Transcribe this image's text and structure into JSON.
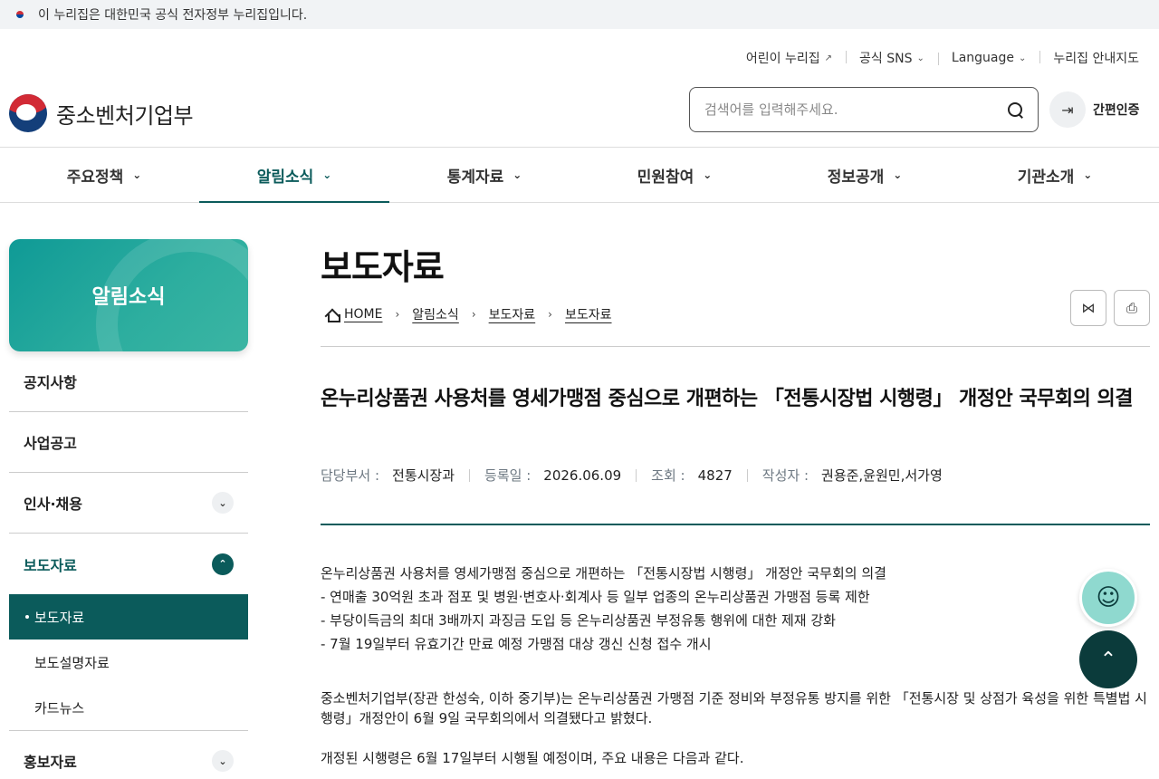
{
  "gov_banner": {
    "text": "이 누리집은 대한민국 공식 전자정부 누리집입니다."
  },
  "utility": [
    {
      "label": "어린이 누리집",
      "icon": "↗"
    },
    {
      "label": "공식 SNS",
      "icon": "⌄"
    },
    {
      "label": "Language",
      "icon": "⌄"
    },
    {
      "label": "누리집 안내지도",
      "icon": ""
    }
  ],
  "logo": {
    "text": "중소벤처기업부"
  },
  "search": {
    "placeholder": "검색어를 입력해주세요."
  },
  "login": {
    "label": "간편인증",
    "icon": "⇥"
  },
  "gnb": [
    {
      "label": "주요정책"
    },
    {
      "label": "알림소식"
    },
    {
      "label": "통계자료"
    },
    {
      "label": "민원참여"
    },
    {
      "label": "정보공개"
    },
    {
      "label": "기관소개"
    }
  ],
  "gnb_chevron": "⌄",
  "side": {
    "banner": "알림소식",
    "items": [
      {
        "label": "공지사항"
      },
      {
        "label": "사업공고"
      },
      {
        "label": "인사·채용",
        "toggle": "⌄"
      },
      {
        "label": "보도자료",
        "toggle": "⌃"
      }
    ],
    "sub": [
      {
        "label": "보도자료"
      },
      {
        "label": "보도설명자료"
      },
      {
        "label": "카드뉴스"
      }
    ],
    "last": {
      "label": "홍보자료",
      "toggle": "⌄"
    }
  },
  "page": {
    "title": "보도자료",
    "breadcrumb": [
      "HOME",
      "알림소식",
      "보도자료",
      "보도자료"
    ],
    "crumb_sep": "›",
    "tools": {
      "share": "⋈",
      "print": "⎙"
    },
    "headline": "온누리상품권 사용처를 영세가맹점 중심으로 개편하는 「전통시장법 시행령」 개정안 국무회의 의결",
    "meta": {
      "dept_label": "담당부서 :",
      "dept": "전통시장과",
      "date_label": "등록일 :",
      "date": "2026.06.09",
      "views_label": "조회 :",
      "views": "4827",
      "author_label": "작성자 :",
      "author": "권용준,윤원민,서가영"
    },
    "body": {
      "lines": [
        "온누리상품권 사용처를 영세가맹점 중심으로 개편하는 「전통시장법 시행령」 개정안 국무회의 의결",
        "- 연매출 30억원 초과 점포 및 병원·변호사·회계사 등 일부 업종의 온누리상품권 가맹점 등록 제한",
        "- 부당이득금의 최대 3배까지 과징금 도입 등 온누리상품권 부정유통 행위에 대한 제재 강화",
        "- 7월 19일부터 유효기간 만료 예정 가맹점 대상 갱신 신청 접수 개시"
      ],
      "para1": "중소벤처기업부(장관 한성숙, 이하 중기부)는 온누리상품권 가맹점 기준 정비와 부정유통 방지를 위한 「전통시장 및 상점가 육성을 위한 특별법 시행령」개정안이 6월 9일 국무회의에서 의결됐다고 밝혔다.",
      "para2": "개정된 시행령은 6월 17일부터 시행될 예정이며, 주요 내용은 다음과 같다."
    }
  },
  "floating": {
    "chatbot_icon": "☺",
    "top_icon": "⌃"
  }
}
